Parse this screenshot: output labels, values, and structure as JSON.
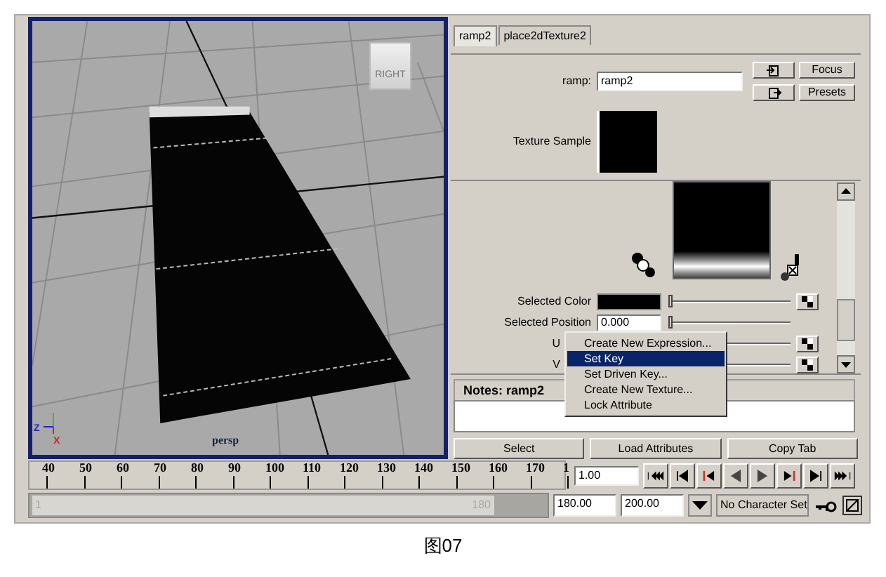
{
  "viewport": {
    "view_cube_label": "RIGHT",
    "camera_label": "persp",
    "axis_labels": [
      "Z",
      "X"
    ]
  },
  "attribute_editor": {
    "tabs": [
      {
        "label": "ramp2",
        "selected": true
      },
      {
        "label": "place2dTexture2",
        "selected": false
      }
    ],
    "node_label": "ramp:",
    "node_name": "ramp2",
    "buttons": [
      "Focus",
      "Presets"
    ],
    "texture_sample_label": "Texture Sample",
    "attributes": [
      {
        "kind": "color",
        "label": "Selected Color",
        "level": 0
      },
      {
        "kind": "number",
        "label": "Selected Position",
        "value": "0.000",
        "level": 0
      },
      {
        "kind": "slider",
        "label": "U"
      },
      {
        "kind": "slider",
        "label": "V"
      }
    ],
    "notes_title": "Notes:  ramp2",
    "buttons_bottom": [
      "Select",
      "Load Attributes",
      "Copy Tab"
    ]
  },
  "context_menu": [
    {
      "label": "Create New Expression...",
      "selected": false
    },
    {
      "label": "Set Key",
      "selected": true
    },
    {
      "label": "Set Driven Key...",
      "selected": false
    },
    {
      "label": "Create New Texture...",
      "selected": false
    },
    {
      "label": "Lock Attribute",
      "selected": false
    }
  ],
  "time_slider": {
    "ticks": [
      "40",
      "50",
      "60",
      "70",
      "80",
      "90",
      "100",
      "110",
      "120",
      "130",
      "140",
      "150",
      "160",
      "170",
      "1"
    ],
    "current_time": "1.00"
  },
  "range_slider": {
    "level": 0.9,
    "start_label": "1",
    "end_label": "180",
    "playback_end": "180.00",
    "animation_end": "200.00",
    "character_set": "No Character Set"
  },
  "caption": "图07"
}
